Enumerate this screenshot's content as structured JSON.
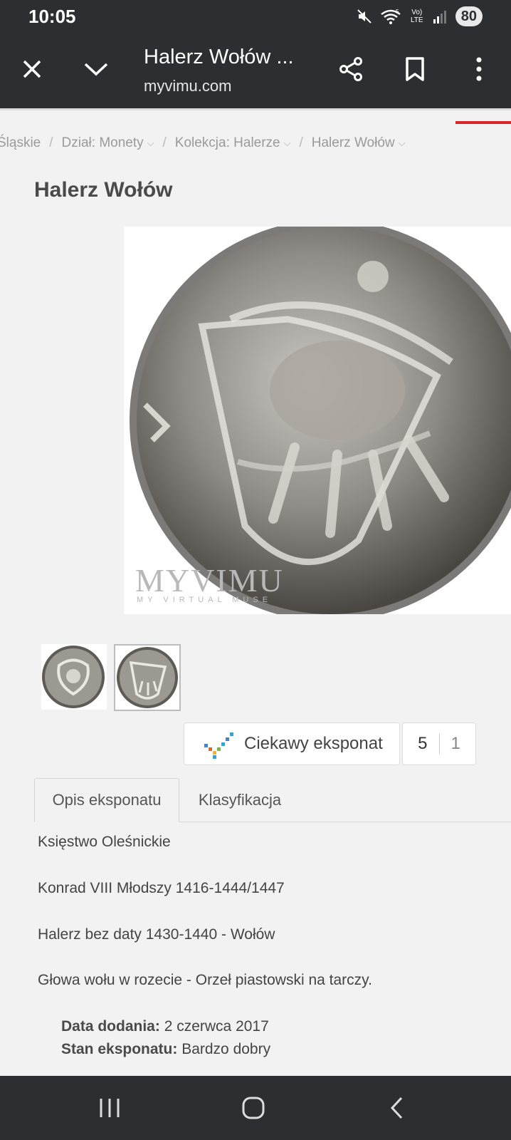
{
  "status_bar": {
    "time": "10:05",
    "network": "Vo) LTE",
    "network_gen": "5",
    "battery": "80"
  },
  "browser": {
    "tab_title": "Halerz Wołów ...",
    "url": "myvimu.com"
  },
  "breadcrumb": [
    {
      "label": "Śląskie",
      "has_dropdown": false
    },
    {
      "label": "Dział: Monety",
      "has_dropdown": true
    },
    {
      "label": "Kolekcja: Halerze",
      "has_dropdown": true
    },
    {
      "label": "Halerz Wołów",
      "has_dropdown": true
    }
  ],
  "exhibit": {
    "title": "Halerz Wołów",
    "watermark": "MYVIMU",
    "watermark_sub": "MY VIRTUAL MUSE",
    "rating_label": "Ciekawy eksponat",
    "rating_count": "5",
    "secondary_count": "1"
  },
  "tabs": [
    {
      "label": "Opis eksponatu",
      "active": true
    },
    {
      "label": "Klasyfikacja",
      "active": false
    }
  ],
  "description": [
    "Księstwo Oleśnickie",
    "Konrad VIII Młodszy 1416-1444/1447",
    "Halerz bez daty 1430-1440 - Wołów",
    "Głowa wołu w rozecie - Orzeł piastowski na tarczy."
  ],
  "meta": {
    "date_added_label": "Data dodania:",
    "date_added_value": "2 czerwca 2017",
    "condition_label": "Stan eksponatu:",
    "condition_value": "Bardzo dobry"
  },
  "colors": {
    "chrome": "#2d2e31",
    "accent_red": "#d9262c",
    "page_bg": "#f2f2f2"
  }
}
